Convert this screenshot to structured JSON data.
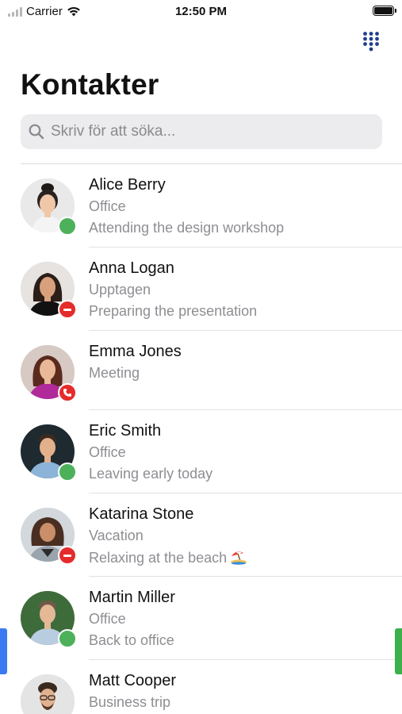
{
  "status_bar": {
    "carrier": "Carrier",
    "time": "12:50 PM"
  },
  "header": {
    "title": "Kontakter",
    "dialpad_icon": "dialpad-icon"
  },
  "search": {
    "placeholder": "Skriv för att söka...",
    "value": ""
  },
  "colors": {
    "available": "#4cb15a",
    "busy": "#e52b2b",
    "dialpad": "#1d3f8f",
    "left_edge_tab": "#3a7af0",
    "right_edge_tab": "#3cb04a"
  },
  "contacts": [
    {
      "name": "Alice Berry",
      "status": "Office",
      "note": "Attending the design workshop",
      "presence": "available"
    },
    {
      "name": "Anna Logan",
      "status": "Upptagen",
      "note": "Preparing the presentation",
      "presence": "busy"
    },
    {
      "name": "Emma Jones",
      "status": "Meeting",
      "note": "",
      "presence": "call"
    },
    {
      "name": "Eric Smith",
      "status": "Office",
      "note": "Leaving early today",
      "presence": "available"
    },
    {
      "name": "Katarina Stone",
      "status": "Vacation",
      "note": "Relaxing at the beach",
      "note_emoji": "beach-umbrella-icon",
      "presence": "busy"
    },
    {
      "name": "Martin Miller",
      "status": "Office",
      "note": "Back to office",
      "presence": "available"
    },
    {
      "name": "Matt Cooper",
      "status": "Business trip",
      "note": "",
      "presence": ""
    }
  ]
}
